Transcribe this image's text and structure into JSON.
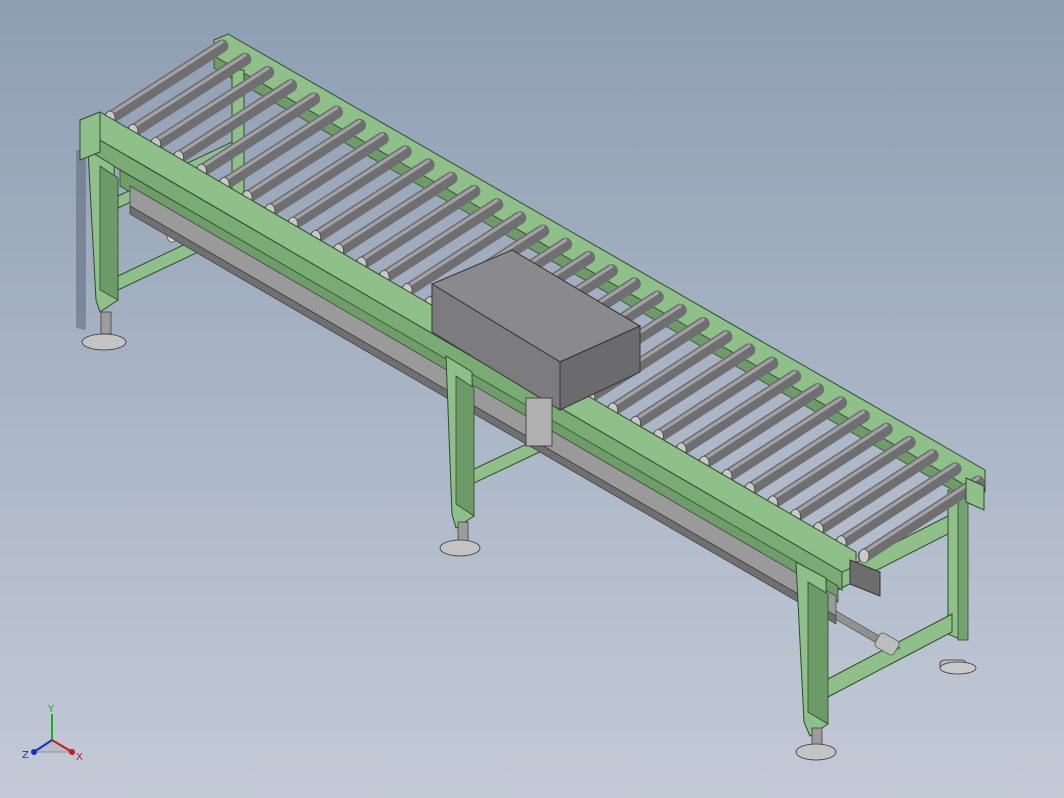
{
  "view": {
    "background_top": "#8e9eb2",
    "background_bottom": "#c3cad6",
    "frame_color": "#8fc08a",
    "frame_edge": "#2f4a2c",
    "roller_color": "#7a7a7c",
    "shaft_color": "#b9b9b9"
  },
  "model": {
    "roller_count": 34,
    "leg_pairs": 3
  },
  "triad": {
    "x_label": "X",
    "y_label": "Y",
    "z_label": "Z",
    "x_color": "#d01818",
    "y_color": "#19b019",
    "z_color": "#1a2ed0"
  }
}
